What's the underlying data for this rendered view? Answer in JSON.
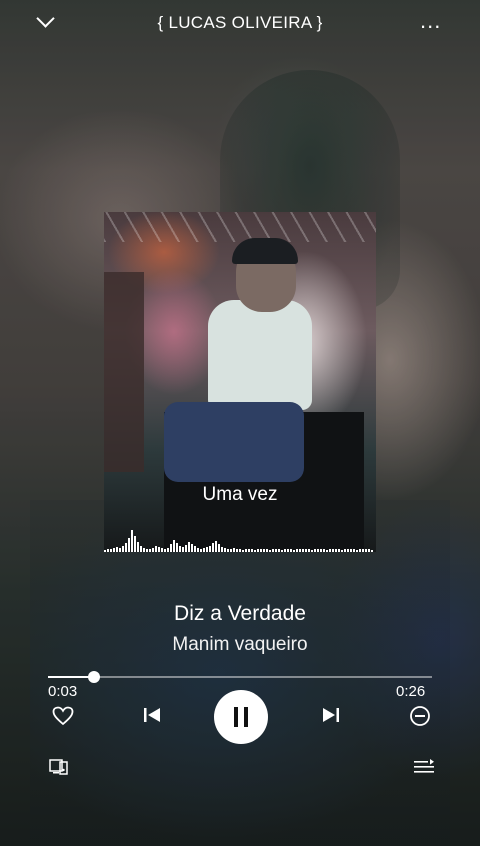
{
  "header": {
    "artist_title": "{ LUCAS OLIVEIRA }",
    "collapse_icon": "chevron-down-icon",
    "more_icon": "more-dots-icon",
    "more_label": "..."
  },
  "artwork": {
    "lyric_line": "Uma vez"
  },
  "song": {
    "title": "Diz a Verdade",
    "artist": "Manim vaqueiro"
  },
  "progress": {
    "current": "0:03",
    "duration": "0:26",
    "fraction": 0.12
  },
  "controls": {
    "favorite_icon": "heart-outline-icon",
    "previous_icon": "skip-previous-icon",
    "play_state_icon": "pause-icon",
    "next_icon": "skip-next-icon",
    "remove_icon": "minus-circle-icon",
    "cast_icon": "device-cast-icon",
    "queue_icon": "queue-list-icon"
  }
}
